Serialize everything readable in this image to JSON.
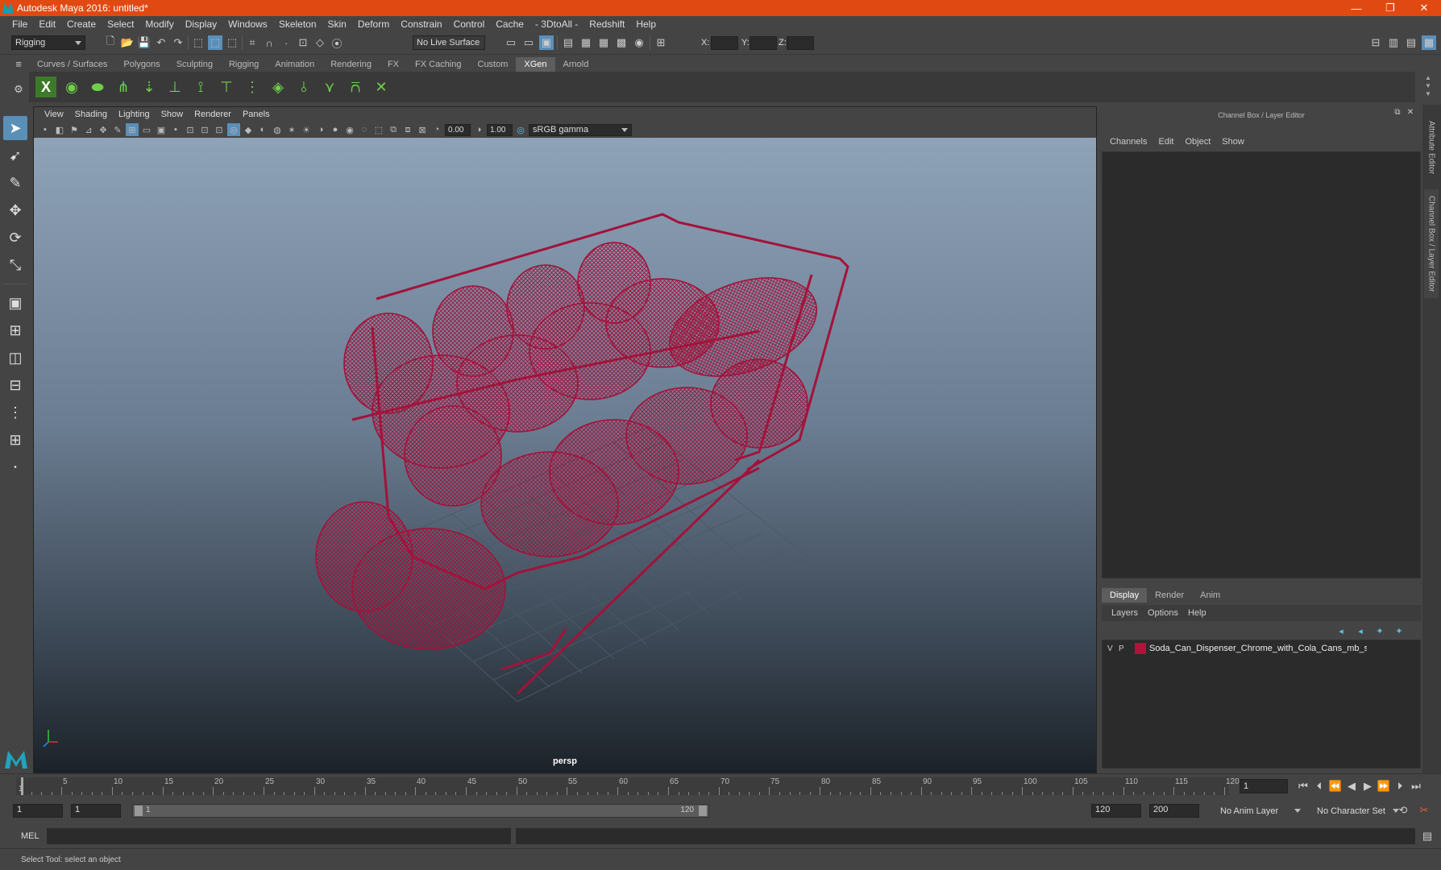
{
  "window": {
    "title": "Autodesk Maya 2016: untitled*",
    "minimize": "—",
    "maximize": "❐",
    "close": "✕"
  },
  "menubar": [
    "File",
    "Edit",
    "Create",
    "Select",
    "Modify",
    "Display",
    "Windows",
    "Skeleton",
    "Skin",
    "Deform",
    "Constrain",
    "Control",
    "Cache",
    "- 3DtoAll -",
    "Redshift",
    "Help"
  ],
  "statusline": {
    "menuset": "Rigging",
    "live_surface": "No Live Surface",
    "x_label": "X:",
    "y_label": "Y:",
    "z_label": "Z:"
  },
  "shelf_tabs": [
    {
      "label": "Curves / Surfaces",
      "active": false
    },
    {
      "label": "Polygons",
      "active": false
    },
    {
      "label": "Sculpting",
      "active": false
    },
    {
      "label": "Rigging",
      "active": false
    },
    {
      "label": "Animation",
      "active": false
    },
    {
      "label": "Rendering",
      "active": false
    },
    {
      "label": "FX",
      "active": false
    },
    {
      "label": "FX Caching",
      "active": false
    },
    {
      "label": "Custom",
      "active": false
    },
    {
      "label": "XGen",
      "active": true
    },
    {
      "label": "Arnold",
      "active": false
    }
  ],
  "viewport": {
    "menu": [
      "View",
      "Shading",
      "Lighting",
      "Show",
      "Renderer",
      "Panels"
    ],
    "exposure": "0.00",
    "gamma": "1.00",
    "color_space": "sRGB gamma",
    "camera": "persp",
    "wire_color": "#a3123a"
  },
  "channel_box": {
    "title": "Channel Box / Layer Editor",
    "menu": [
      "Channels",
      "Edit",
      "Object",
      "Show"
    ]
  },
  "layer_editor": {
    "tabs": [
      "Display",
      "Render",
      "Anim"
    ],
    "menu": [
      "Layers",
      "Options",
      "Help"
    ],
    "layers": [
      {
        "v": "V",
        "p": "P",
        "color": "#b3123a",
        "name": "Soda_Can_Dispenser_Chrome_with_Cola_Cans_mb_stanc"
      }
    ]
  },
  "side_tabs": [
    "Attribute Editor",
    "Channel Box / Layer Editor"
  ],
  "timeline": {
    "ticks": [
      "5",
      "10",
      "15",
      "20",
      "25",
      "30",
      "35",
      "40",
      "45",
      "50",
      "55",
      "60",
      "65",
      "70",
      "75",
      "80",
      "85",
      "90",
      "95",
      "100",
      "105",
      "110",
      "115",
      "120"
    ],
    "start_marker": "1",
    "end_marker": "120",
    "current_frame": "1"
  },
  "range": {
    "start": "1",
    "playback_start": "1",
    "slider_start": "1",
    "slider_end": "120",
    "playback_end": "120",
    "end": "200",
    "anim_layer": "No Anim Layer",
    "character_set": "No Character Set"
  },
  "command_line": {
    "label": "MEL"
  },
  "help_line": "Select Tool: select an object"
}
